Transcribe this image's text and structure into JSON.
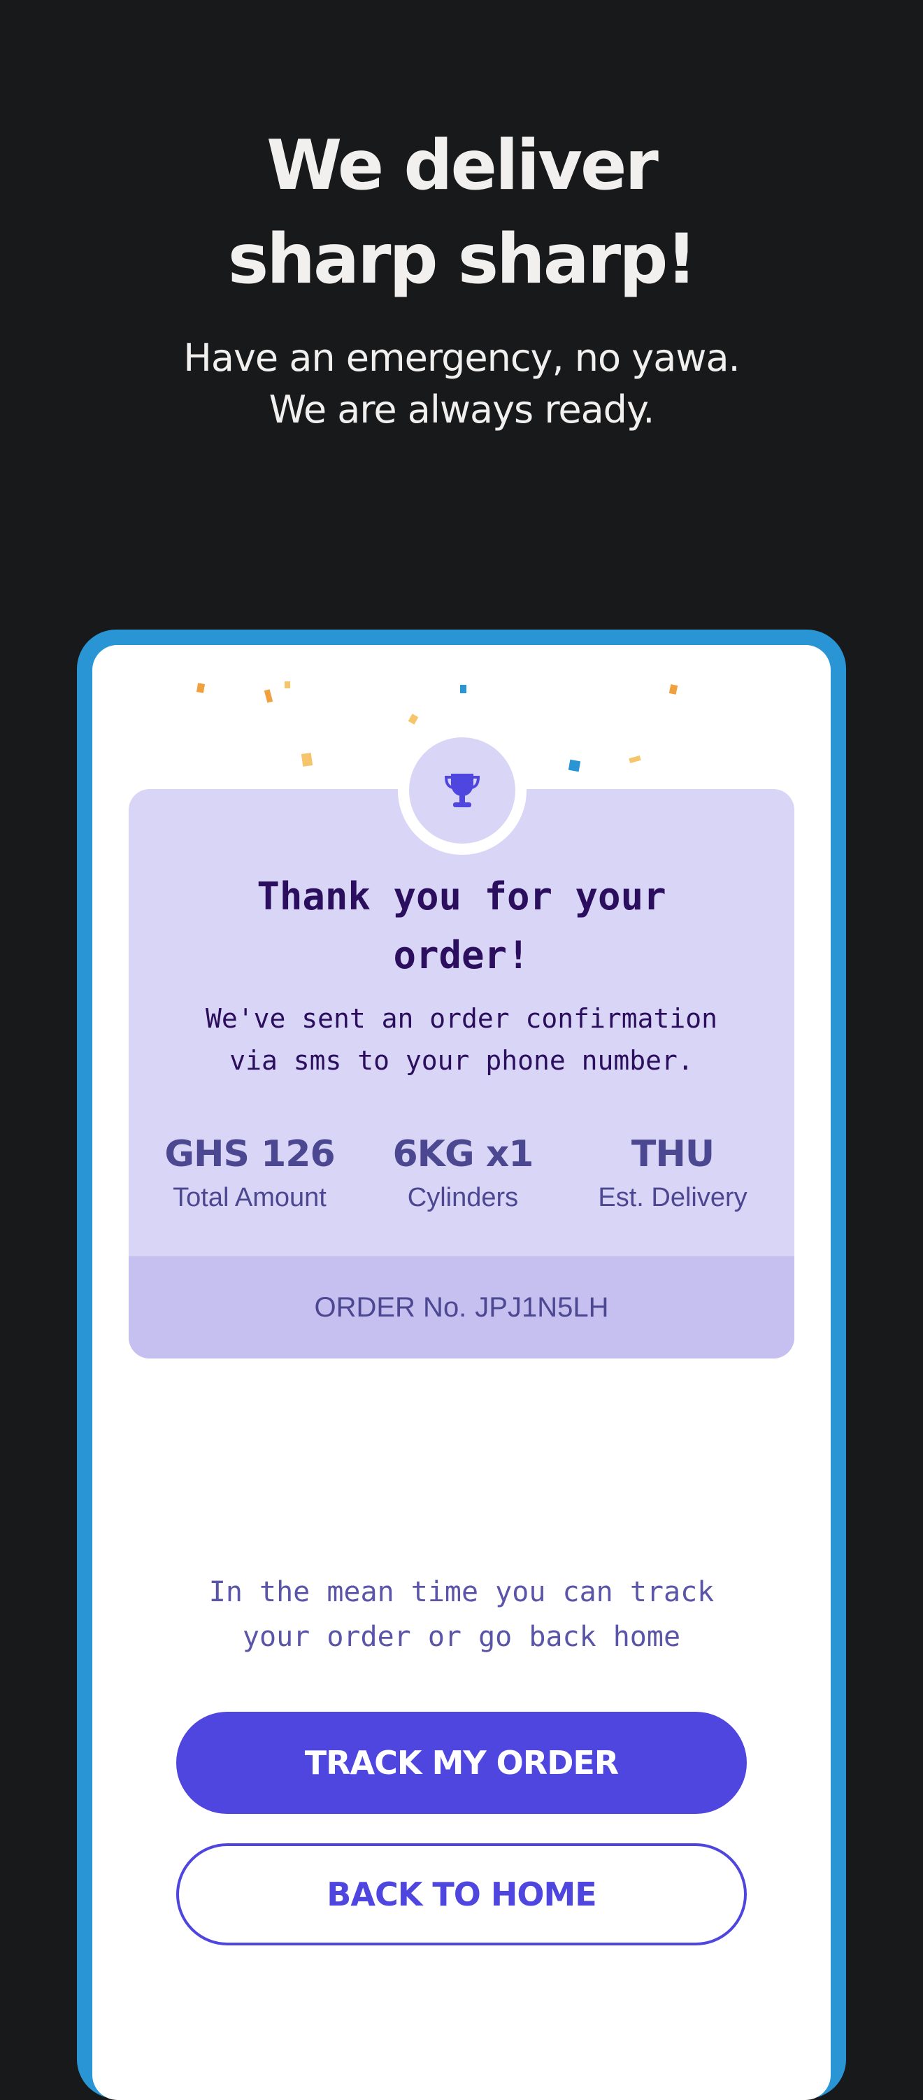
{
  "hero": {
    "title_line1": "We deliver",
    "title_line2": "sharp sharp!",
    "subtitle_line1": "Have an emergency, no yawa.",
    "subtitle_line2": "We are always ready."
  },
  "confirmation": {
    "icon": "trophy-icon",
    "title_line1": "Thank you for your",
    "title_line2": "order!",
    "message_line1": "We've sent an order confirmation",
    "message_line2": "via sms to your phone number.",
    "stats": [
      {
        "value": "GHS 126",
        "label": "Total Amount"
      },
      {
        "value": "6KG x1",
        "label": "Cylinders"
      },
      {
        "value": "THU",
        "label": "Est. Delivery"
      }
    ],
    "order_label": "ORDER No.",
    "order_number": "JPJ1N5LH"
  },
  "footer": {
    "hint_line1": "In the mean time you can track",
    "hint_line2": "your order or go back home",
    "track_button": "TRACK MY ORDER",
    "home_button": "BACK TO HOME"
  },
  "colors": {
    "background": "#18191b",
    "device_frame": "#2a95d5",
    "card": "#d9d5f6",
    "order_strip": "#c5c0ef",
    "accent": "#4f46e0",
    "title_text": "#2b0f5e",
    "stat_text": "#4c4791"
  }
}
